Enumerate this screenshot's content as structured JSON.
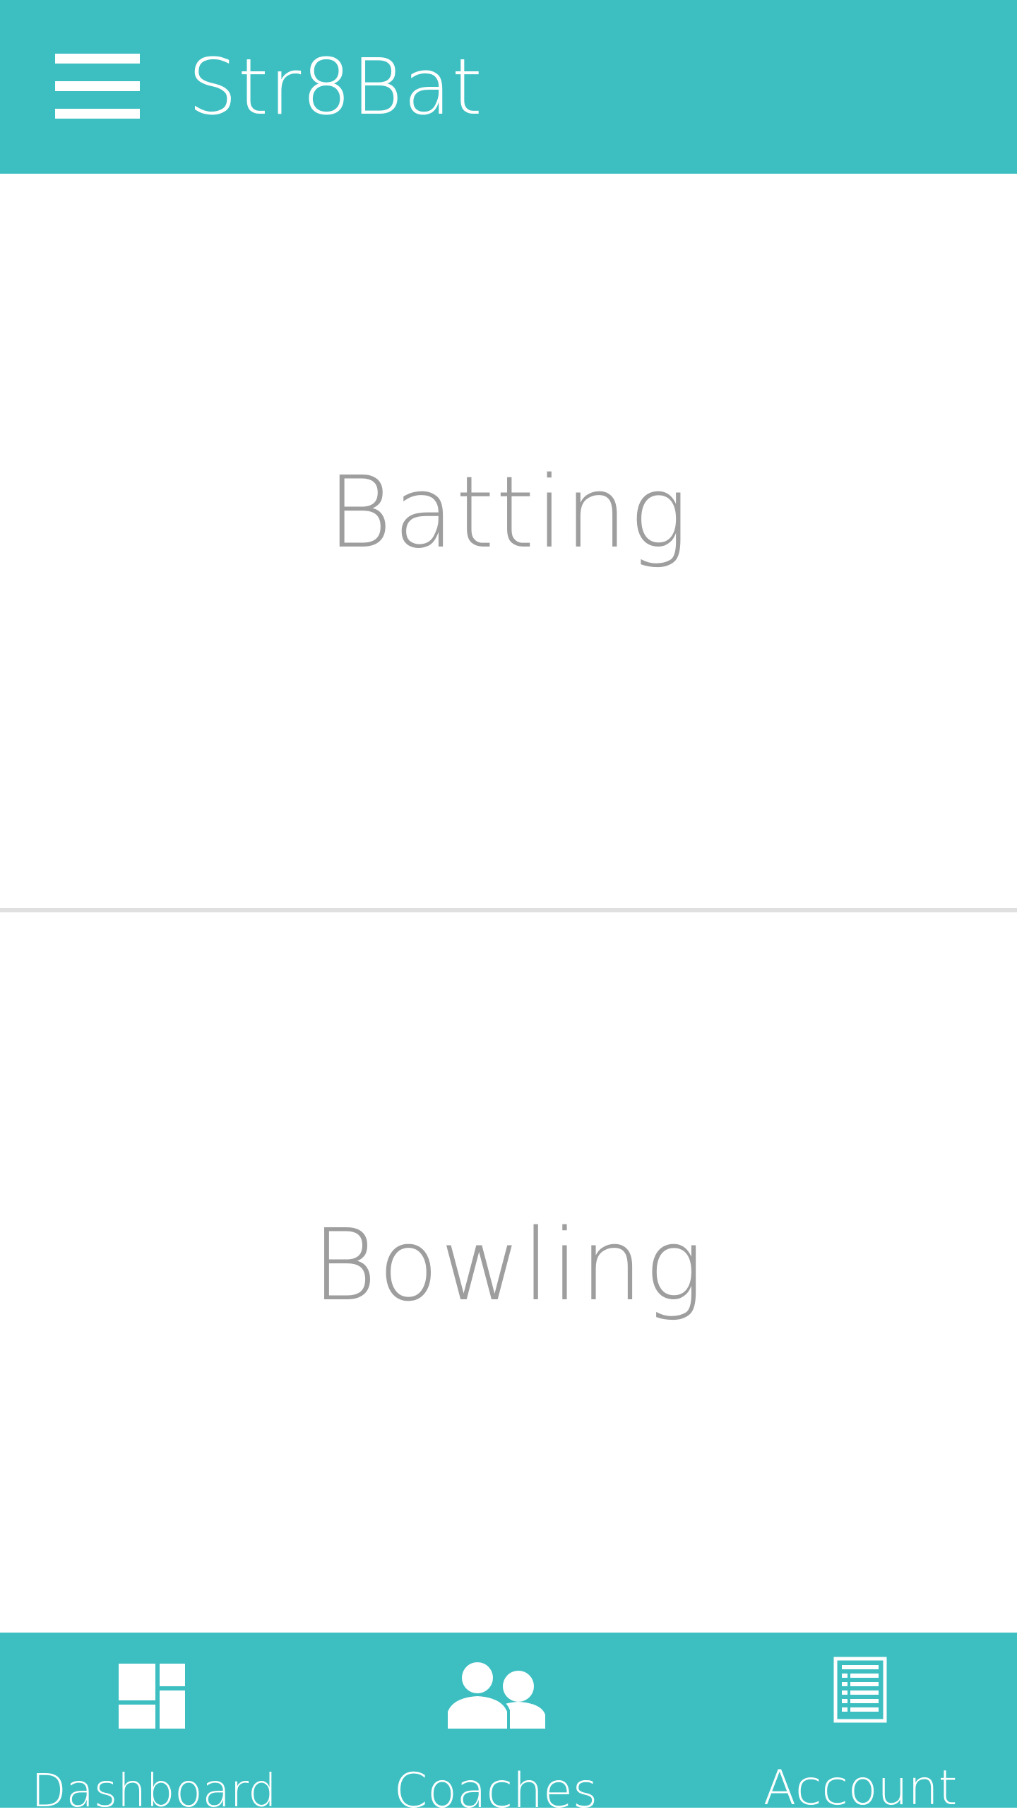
{
  "app_bar": {
    "title": "Str8Bat",
    "menu_icon": "hamburger-menu-icon",
    "background_color": "#3dbfc1"
  },
  "sections": [
    {
      "label": "Batting"
    },
    {
      "label": "Bowling"
    }
  ],
  "bottom_nav": {
    "background_color": "#3dbfc1",
    "items": [
      {
        "label": "Dashboard",
        "icon": "dashboard-icon"
      },
      {
        "label": "Coaches",
        "icon": "coaches-icon"
      },
      {
        "label": "Account",
        "icon": "account-icon"
      }
    ]
  }
}
